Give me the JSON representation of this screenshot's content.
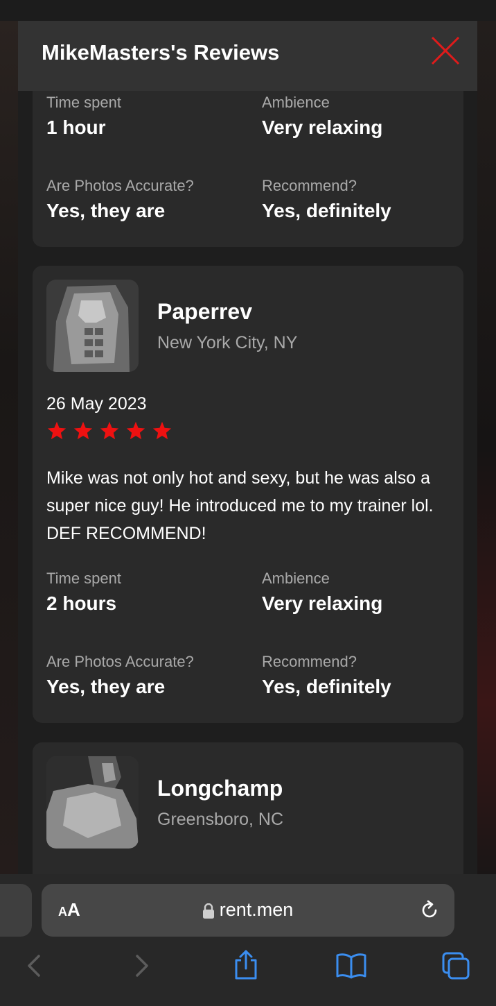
{
  "modal": {
    "title": "MikeMasters's Reviews"
  },
  "reviews": [
    {
      "details": {
        "time_label": "Time spent",
        "time_value": "1 hour",
        "ambience_label": "Ambience",
        "ambience_value": "Very relaxing",
        "photos_label": "Are Photos Accurate?",
        "photos_value": "Yes, they are",
        "recommend_label": "Recommend?",
        "recommend_value": "Yes, definitely"
      }
    },
    {
      "name": "Paperrev",
      "location": "New York City, NY",
      "date": "26 May 2023",
      "rating": 5,
      "text": "Mike was not only hot and sexy, but he was also a super nice guy! He introduced me to my trainer lol. DEF RECOMMEND!",
      "details": {
        "time_label": "Time spent",
        "time_value": "2 hours",
        "ambience_label": "Ambience",
        "ambience_value": "Very relaxing",
        "photos_label": "Are Photos Accurate?",
        "photos_value": "Yes, they are",
        "recommend_label": "Recommend?",
        "recommend_value": "Yes, definitely"
      }
    },
    {
      "name": "Longchamp",
      "location": "Greensboro, NC"
    }
  ],
  "browser": {
    "text_size_label_small": "A",
    "text_size_label_big": "A",
    "url": "rent.men"
  },
  "icons": {
    "close": "close-icon",
    "star": "star-icon",
    "lock": "lock-icon",
    "reload": "reload-icon",
    "back": "chevron-left-icon",
    "forward": "chevron-right-icon",
    "share": "share-icon",
    "bookmarks": "book-icon",
    "tabs": "tabs-icon"
  },
  "colors": {
    "accent_red": "#e01b1b",
    "ios_blue": "#3b8ef0"
  }
}
